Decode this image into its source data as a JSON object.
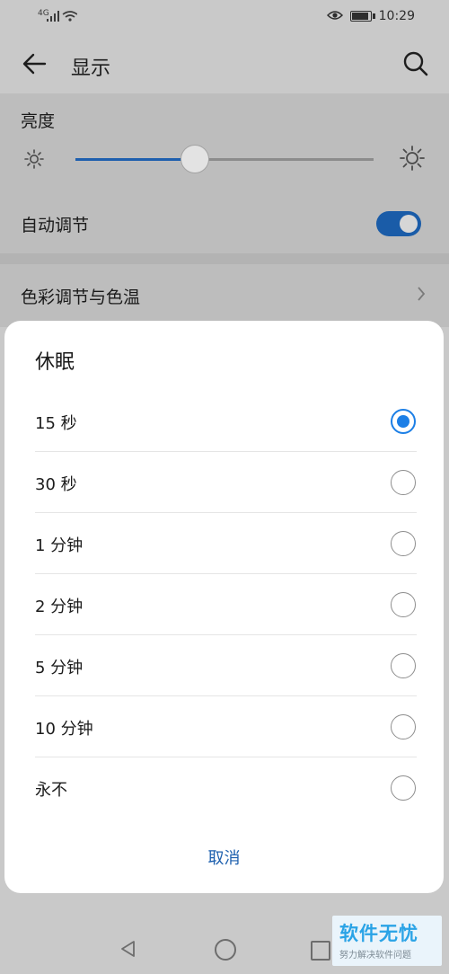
{
  "status_bar": {
    "network": "4G",
    "time": "10:29"
  },
  "app_bar": {
    "title": "显示"
  },
  "brightness": {
    "label": "亮度",
    "level": 0.4
  },
  "auto_adjust": {
    "label": "自动调节",
    "enabled": true
  },
  "color_item": {
    "label": "色彩调节与色温"
  },
  "dialog": {
    "title": "休眠",
    "options": [
      {
        "label": "15 秒",
        "selected": true
      },
      {
        "label": "30 秒",
        "selected": false
      },
      {
        "label": "1 分钟",
        "selected": false
      },
      {
        "label": "2 分钟",
        "selected": false
      },
      {
        "label": "5 分钟",
        "selected": false
      },
      {
        "label": "10 分钟",
        "selected": false
      },
      {
        "label": "永不",
        "selected": false
      }
    ],
    "cancel_label": "取消"
  },
  "watermark": {
    "main": "软件无忧",
    "sub": "努力解决软件问题"
  },
  "colors": {
    "accent": "#1c7fe6",
    "toggle": "#1a5ca8",
    "cancel": "#1c5fae"
  }
}
